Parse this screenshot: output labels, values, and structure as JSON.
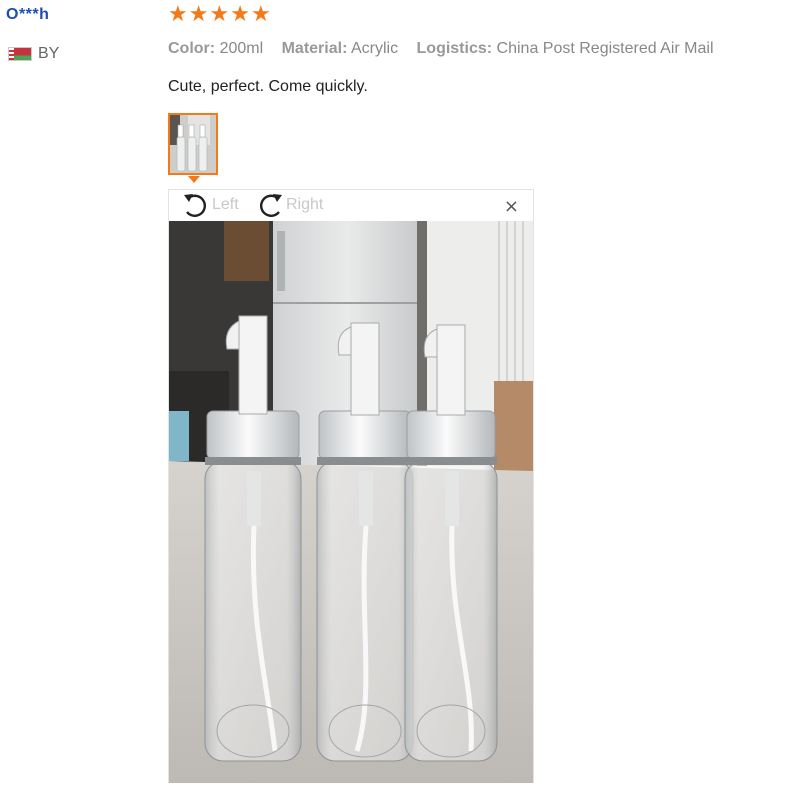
{
  "review": {
    "user": "O***h",
    "country_code": "BY",
    "flag": "belarus-flag",
    "rating": 5,
    "rating_max": 5,
    "star_color": "#f47a19",
    "attributes": [
      {
        "key": "Color:",
        "value": "200ml"
      },
      {
        "key": "Material:",
        "value": "Acrylic"
      },
      {
        "key": "Logistics:",
        "value": "China Post Registered Air Mail"
      }
    ],
    "text": "Cute, perfect. Come quickly."
  },
  "viewer": {
    "rotate_left_label": "Left",
    "rotate_right_label": "Right",
    "close_label": "×",
    "photo": "three-clear-pump-bottles-photo"
  }
}
